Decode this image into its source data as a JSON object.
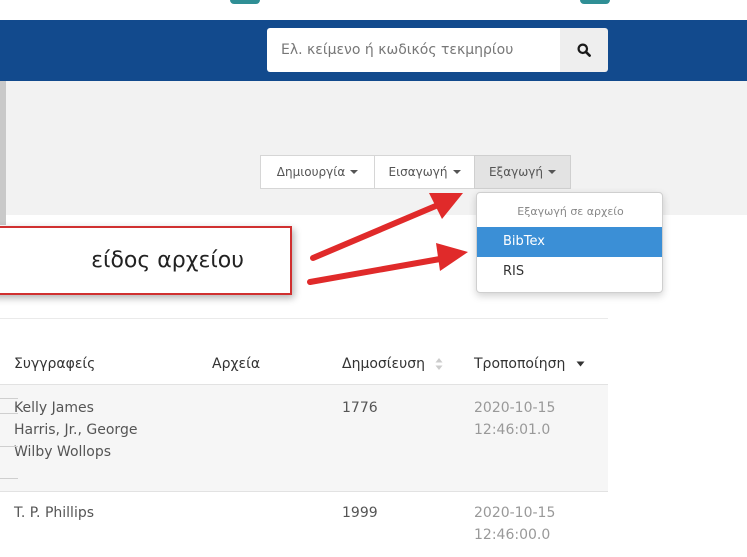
{
  "search": {
    "placeholder": "Ελ. κείμενο ή κωδικός τεκμηρίου"
  },
  "toolbar": {
    "buttons": [
      {
        "label": "Δημιουργία"
      },
      {
        "label": "Εισαγωγή"
      },
      {
        "label": "Εξαγωγή"
      }
    ]
  },
  "export_menu": {
    "header": "Εξαγωγή σε αρχείο",
    "items": [
      {
        "label": "BibTex"
      },
      {
        "label": "RIS"
      }
    ]
  },
  "callout": {
    "text": "είδος αρχείου"
  },
  "table": {
    "headers": {
      "authors": "Συγγραφείς",
      "files": "Αρχεία",
      "published": "Δημοσίευση",
      "modified": "Τροποποίηση"
    },
    "rows": [
      {
        "authors": [
          "Kelly James",
          "Harris, Jr., George",
          "Wilby Wollops"
        ],
        "files": "",
        "published": "1776",
        "modified_date": "2020-10-15",
        "modified_time": "12:46:01.0"
      },
      {
        "authors": [
          "T. P. Phillips"
        ],
        "files": "",
        "published": "1999",
        "modified_date": "2020-10-15",
        "modified_time": "12:46:00.0"
      }
    ]
  },
  "colors": {
    "navbar": "#124a8d",
    "highlight": "#3b8fd6",
    "arrow": "#e02a2a",
    "callout_border": "#d03030"
  },
  "icons": {
    "search": "search-icon",
    "sort_neutral": "sort-icon",
    "sort_desc": "caret-down-icon"
  }
}
